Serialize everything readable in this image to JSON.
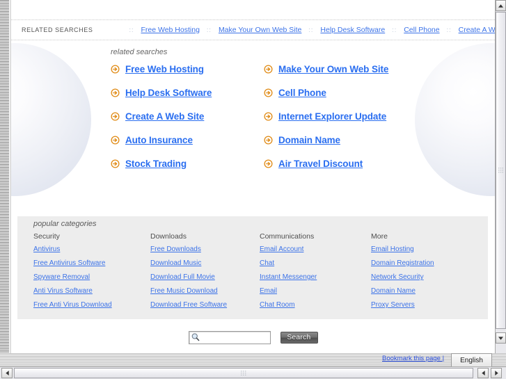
{
  "colors": {
    "link_blue": "#3b72e8",
    "main_link_blue": "#2a6ef0",
    "bullet_orange": "#e88a12",
    "panel_gray": "#ededed"
  },
  "top_strip": {
    "label": "RELATED SEARCHES",
    "separator": "::",
    "links": [
      "Free Web Hosting",
      "Make Your Own Web Site",
      "Help Desk Software",
      "Cell Phone",
      "Create A Web Site"
    ]
  },
  "related_searches": {
    "caption": "related searches",
    "bullet_icon": "circle-arrow-right-icon",
    "items": [
      "Free Web Hosting",
      "Make Your Own Web Site",
      "Help Desk Software",
      "Cell Phone",
      "Create A Web Site",
      "Internet Explorer Update",
      "Auto Insurance",
      "Domain Name",
      "Stock Trading",
      "Air Travel Discount"
    ]
  },
  "popular_categories": {
    "caption": "popular categories",
    "columns": [
      {
        "heading": "Security",
        "links": [
          "Antivirus",
          "Free Antivirus Software",
          "Spyware Removal",
          "Anti Virus Software",
          "Free Anti Virus Download"
        ]
      },
      {
        "heading": "Downloads",
        "links": [
          "Free Downloads",
          "Download Music",
          "Download Full Movie",
          "Free Music Download",
          "Download Free Software"
        ]
      },
      {
        "heading": "Communications",
        "links": [
          "Email Account",
          "Chat",
          "Instant Messenger",
          "Email",
          "Chat Room"
        ]
      },
      {
        "heading": "More",
        "links": [
          "Email Hosting",
          "Domain Registration",
          "Network Security",
          "Domain Name",
          "Proxy Servers"
        ]
      }
    ]
  },
  "search": {
    "icon": "magnifier-icon",
    "value": "",
    "placeholder": "",
    "button_label": "Search"
  },
  "footer": {
    "bookmark_label": "Bookmark this page |",
    "language": "English"
  },
  "scrollbars": {
    "vertical_up": "caret-up-icon",
    "vertical_down": "caret-down-icon",
    "horizontal_left": "caret-left-icon",
    "horizontal_right": "caret-right-icon"
  }
}
